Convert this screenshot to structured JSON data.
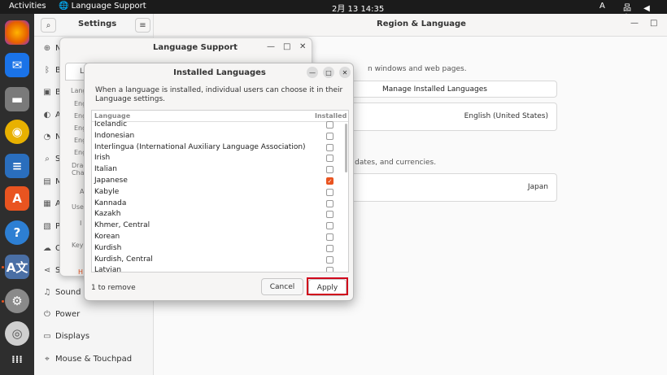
{
  "topbar": {
    "activities": "Activities",
    "app_name": "Language Support",
    "clock": "2月 13  14:35",
    "input_method": "A",
    "tray": "品 ◀ ⏻"
  },
  "settings": {
    "title": "Settings",
    "content_title": "Region & Language",
    "sidebar_items": [
      {
        "label": "N",
        "icon": "network-icon"
      },
      {
        "label": "B",
        "icon": "bluetooth-icon"
      },
      {
        "label": "B",
        "icon": "background-icon"
      },
      {
        "label": "A",
        "icon": "appearance-icon"
      },
      {
        "label": "N",
        "icon": "notifications-icon"
      },
      {
        "label": "S",
        "icon": "search-icon"
      },
      {
        "label": "M",
        "icon": "multitasking-icon"
      },
      {
        "label": "A",
        "icon": "applications-icon"
      },
      {
        "label": "P",
        "icon": "privacy-icon"
      },
      {
        "label": "O",
        "icon": "online-accounts-icon"
      },
      {
        "label": "S",
        "icon": "sharing-icon"
      },
      {
        "label": "Sound",
        "icon": "sound-icon"
      },
      {
        "label": "Power",
        "icon": "power-icon"
      },
      {
        "label": "Displays",
        "icon": "displays-icon"
      },
      {
        "label": "Mouse & Touchpad",
        "icon": "mouse-icon"
      }
    ],
    "lang_desc_fragment": "n windows and web pages.",
    "manage_button": "Manage Installed Languages",
    "language_value": "English (United States)",
    "formats_desc_fragment": "rs, dates, and currencies.",
    "formats_value": "Japan"
  },
  "language_support": {
    "title": "Language Support",
    "tab_fragment": "La",
    "fragments": [
      "Langu",
      "Eng",
      "Eng",
      "Eng",
      "Eng",
      "Eng",
      "Drag",
      "Chan",
      "A",
      "Use t",
      "I",
      "Key",
      "H"
    ]
  },
  "dialog": {
    "title": "Installed Languages",
    "description": "When a language is installed, individual users can choose it in their Language settings.",
    "col_language": "Language",
    "col_installed": "Installed",
    "languages": [
      {
        "name": "Icelandic",
        "installed": false
      },
      {
        "name": "Indonesian",
        "installed": false
      },
      {
        "name": "Interlingua (International Auxiliary Language Association)",
        "installed": false
      },
      {
        "name": "Irish",
        "installed": false
      },
      {
        "name": "Italian",
        "installed": false
      },
      {
        "name": "Japanese",
        "installed": true
      },
      {
        "name": "Kabyle",
        "installed": false
      },
      {
        "name": "Kannada",
        "installed": false
      },
      {
        "name": "Kazakh",
        "installed": false
      },
      {
        "name": "Khmer, Central",
        "installed": false
      },
      {
        "name": "Korean",
        "installed": false
      },
      {
        "name": "Kurdish",
        "installed": false
      },
      {
        "name": "Kurdish, Central",
        "installed": false
      },
      {
        "name": "Latvian",
        "installed": false
      }
    ],
    "status": "1 to remove",
    "cancel": "Cancel",
    "apply": "Apply"
  },
  "colors": {
    "accent": "#e95420",
    "highlight": "#d0021b",
    "dock": "#2e2e2e"
  }
}
